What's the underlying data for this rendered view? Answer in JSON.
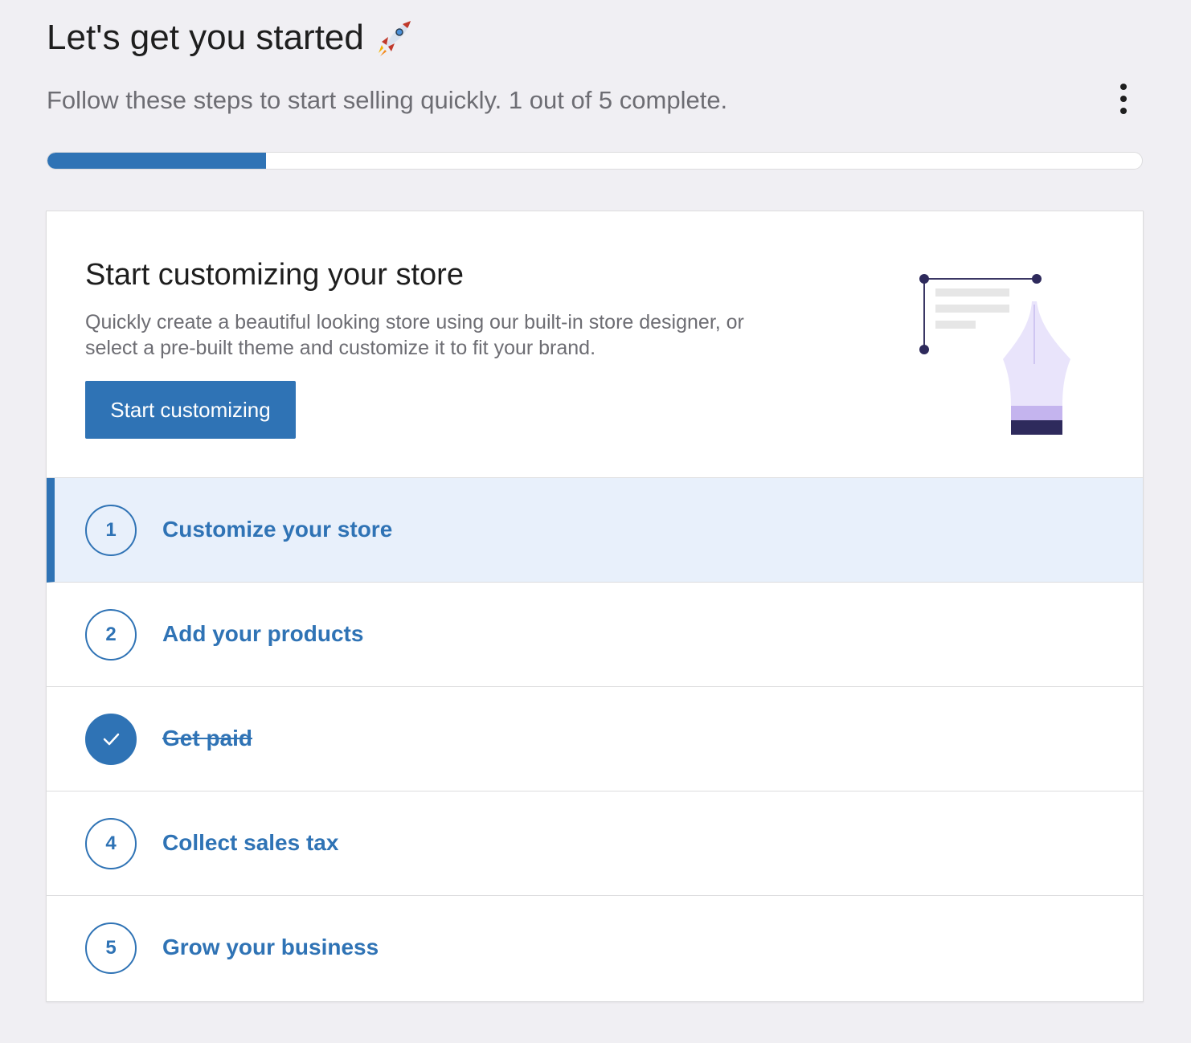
{
  "header": {
    "title": "Let's get you started",
    "rocket_icon": "rocket-icon",
    "subtitle": "Follow these steps to start selling quickly. 1 out of 5 complete."
  },
  "menu": {
    "icon": "more-vertical-icon"
  },
  "progress": {
    "completed": 1,
    "total": 5,
    "fraction": 0.2
  },
  "hero": {
    "title": "Start customizing your store",
    "description": "Quickly create a beautiful looking store using our built-in store designer, or select a pre-built theme and customize it to fit your brand.",
    "button_label": "Start customizing",
    "illustration_icon": "pen-design-illustration"
  },
  "steps": [
    {
      "number": "1",
      "label": "Customize your store",
      "state": "active"
    },
    {
      "number": "2",
      "label": "Add your products",
      "state": "todo"
    },
    {
      "number": "",
      "label": "Get paid",
      "state": "complete"
    },
    {
      "number": "4",
      "label": "Collect sales tax",
      "state": "todo"
    },
    {
      "number": "5",
      "label": "Grow your business",
      "state": "todo"
    }
  ],
  "colors": {
    "accent": "#2f73b5",
    "active_row": "#e8f0fb",
    "background": "#f0eff3",
    "muted_text": "#6d6d73"
  }
}
